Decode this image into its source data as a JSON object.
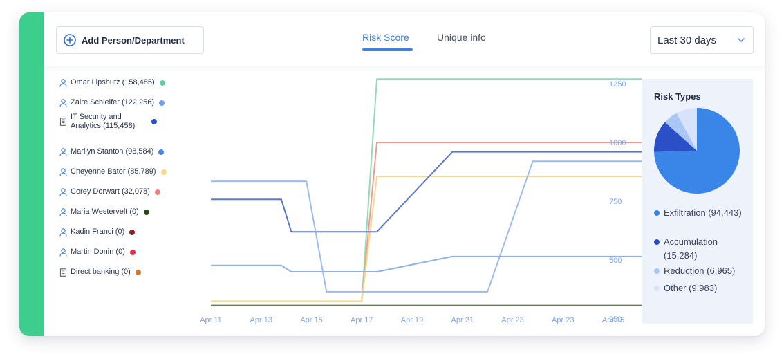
{
  "toolbar": {
    "add_label": "Add Person/Department",
    "tabs": [
      {
        "label": "Risk Score",
        "active": true
      },
      {
        "label": "Unique info",
        "active": false
      }
    ],
    "range": {
      "selected": "Last 30 days"
    }
  },
  "legend": [
    {
      "label": "Omar Lipshutz (158,485)",
      "icon": "person-icon",
      "color": "#5fd39b"
    },
    {
      "label": "Zaire Schleifer (122,256)",
      "icon": "person-icon",
      "color": "#6f9ef0"
    },
    {
      "label": "IT Security and Analytics (115,458)",
      "icon": "building-icon",
      "color": "#2b4fc7"
    },
    {
      "label": "Marilyn Stanton (98,584)",
      "icon": "person-icon",
      "color": "#4a86e8"
    },
    {
      "label": "Cheyenne Bator (85,789)",
      "icon": "person-icon",
      "color": "#f7d98a"
    },
    {
      "label": "Corey Dorwart (32,078)",
      "icon": "person-icon",
      "color": "#ee7f7f"
    },
    {
      "label": "Maria Westervelt (0)",
      "icon": "person-icon",
      "color": "#2e4a1c"
    },
    {
      "label": "Kadin Franci (0)",
      "icon": "person-icon",
      "color": "#8a1f2c"
    },
    {
      "label": "Martin Donin (0)",
      "icon": "person-icon",
      "color": "#e0334e"
    },
    {
      "label": "Direct banking (0)",
      "icon": "building-icon",
      "color": "#d57a2a"
    }
  ],
  "chart_data": [
    {
      "type": "line",
      "categories": [
        "Apr 11",
        "Apr 13",
        "Apr 15",
        "Apr 17",
        "Apr 19",
        "Apr 21",
        "Apr 23",
        "Apr 23",
        "Apr 15"
      ],
      "ylim": [
        250,
        1250
      ],
      "yticks": [
        1250,
        1000,
        750,
        500,
        250
      ],
      "grid": false,
      "series": [
        {
          "color": "#8fdcb6",
          "points": [
            [
              0,
              325
            ],
            [
              3,
              325
            ],
            [
              3.3,
              1270
            ],
            [
              8.6,
              1270
            ]
          ]
        },
        {
          "color": "#f29a92",
          "points": [
            [
              0,
              325
            ],
            [
              3,
              325
            ],
            [
              3.3,
              1000
            ],
            [
              8.6,
              1000
            ]
          ]
        },
        {
          "color": "#f7d98a",
          "points": [
            [
              0,
              325
            ],
            [
              3,
              325
            ],
            [
              3.3,
              855
            ],
            [
              8.6,
              855
            ]
          ]
        },
        {
          "color": "#5a78d4",
          "points": [
            [
              0,
              758
            ],
            [
              1.4,
              758
            ],
            [
              1.6,
              620
            ],
            [
              3.3,
              620
            ],
            [
              4.8,
              960
            ],
            [
              8.6,
              960
            ]
          ]
        },
        {
          "color": "#9cbbf2",
          "points": [
            [
              0,
              835
            ],
            [
              1.9,
              835
            ],
            [
              2.3,
              365
            ],
            [
              5.5,
              365
            ],
            [
              6.4,
              920
            ],
            [
              8.6,
              920
            ]
          ]
        },
        {
          "color": "#8fb0ef",
          "points": [
            [
              0,
              477
            ],
            [
              1.4,
              477
            ],
            [
              1.6,
              450
            ],
            [
              3.3,
              450
            ],
            [
              4.8,
              515
            ],
            [
              8.6,
              515
            ]
          ]
        },
        {
          "color": "#6b7a5a",
          "points": [
            [
              0,
              307
            ],
            [
              8.6,
              307
            ]
          ]
        }
      ]
    },
    {
      "type": "pie",
      "title": "Risk Types",
      "slices": [
        {
          "label": "Exfiltration (94,443)",
          "value": 94443,
          "color": "#3a86e8"
        },
        {
          "label": "Accumulation (15,284)",
          "value": 15284,
          "color": "#2b4fc7"
        },
        {
          "label": "Reduction (6,965)",
          "value": 6965,
          "color": "#a9c6f5"
        },
        {
          "label": "Other (9,983)",
          "value": 9983,
          "color": "#d6e3fa"
        }
      ]
    }
  ]
}
